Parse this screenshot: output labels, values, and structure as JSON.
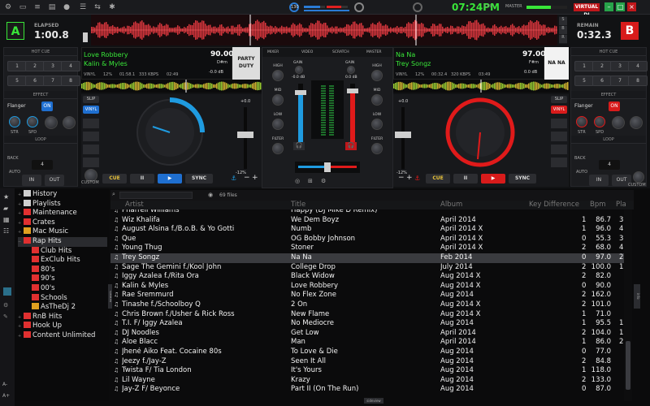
{
  "topbar": {
    "clock": "07:24PM",
    "cpu_label": "CPU",
    "master_label": "MASTER",
    "brand": "VIRTUAL DJ",
    "icons": [
      "settings-icon",
      "monitor-icon",
      "mixer-icon",
      "sampler-icon",
      "record-icon",
      "playlist-icon",
      "sync-icon",
      "gear-icon"
    ],
    "meter_colors": [
      "#2a7bd5",
      "#e02020",
      "#2a7bd5",
      "#e02020",
      "#aaaaaa"
    ],
    "window_buttons": [
      {
        "name": "min",
        "color": "#27a34a"
      },
      {
        "name": "max",
        "color": "#27a34a"
      },
      {
        "name": "close",
        "color": "#c0171b"
      }
    ],
    "badge": "130"
  },
  "deckA": {
    "letter": "A",
    "time_label": "ELAPSED",
    "time": "1:00.8",
    "hot_cue_label": "HOT CUE",
    "hot_cues": [
      "1",
      "2",
      "3",
      "4",
      "5",
      "6",
      "7",
      "8"
    ],
    "effect_label": "EFFECT",
    "effect_name": "Flanger",
    "effect_on": "ON",
    "effect_knobs": [
      "STR",
      "SPD"
    ],
    "loop_label": "LOOP",
    "loop_value": "4",
    "back_label": "BACK",
    "auto_label": "AUTO",
    "in_label": "IN",
    "out_label": "OUT",
    "custom_label": "CUSTOM",
    "slip_label": "SLIP",
    "vinyl_label": "VINYL",
    "title": "Love Robbery",
    "artist": "Kalin & Myles",
    "bpm": "90.00",
    "key": "D#m",
    "gain": "-0.0 dB",
    "info_vinyl": "VINYL",
    "info_pitch": "12%",
    "info_time": "01:58.1",
    "info_kbps": "333 KBPS",
    "info_remain": "02:49",
    "pitch_max": "+0.0",
    "pitch_min": "-12%",
    "cue_label": "CUE",
    "play_symbol": "▶",
    "pause_symbol": "II",
    "sync_label": "SYNC",
    "accent": "#1f9be0",
    "art_text": "PARTY\nDUTY"
  },
  "deckB": {
    "letter": "B",
    "time_label": "REMAIN",
    "time": "0:32.3",
    "hot_cue_label": "HOT CUE",
    "hot_cues": [
      "1",
      "2",
      "3",
      "4",
      "5",
      "6",
      "7",
      "8"
    ],
    "effect_label": "EFFECT",
    "effect_name": "Flanger",
    "effect_on": "ON",
    "effect_knobs": [
      "STR",
      "SPD"
    ],
    "loop_label": "LOOP",
    "loop_value": "4",
    "back_label": "BACK",
    "auto_label": "AUTO",
    "in_label": "IN",
    "out_label": "OUT",
    "custom_label": "CUSTOM",
    "slip_label": "SLIP",
    "vinyl_label": "VINYL",
    "title": "Na Na",
    "artist": "Trey Songz",
    "bpm": "97.00",
    "key": "F#m",
    "gain": "0.0 dB",
    "info_vinyl": "VINYL",
    "info_pitch": "12%",
    "info_time": "00:32.4",
    "info_kbps": "320 KBPS",
    "info_remain": "03:49",
    "pitch_max": "+0.0",
    "pitch_min": "-12%",
    "cue_label": "CUE",
    "play_symbol": "▶",
    "pause_symbol": "II",
    "sync_label": "SYNC",
    "accent": "#e01a1a",
    "art_text": "NA NA"
  },
  "mixer": {
    "tabs": [
      "MIXER",
      "VIDEO",
      "SCRATCH",
      "MASTER"
    ],
    "knobs": [
      "GAIN",
      "HIGH",
      "MID",
      "LOW",
      "FILTER"
    ],
    "gain_a": "-0.0 dB",
    "gain_b": "0.0 dB"
  },
  "browser": {
    "tree": [
      {
        "label": "History",
        "color": "#cfcfcf",
        "indent": 0,
        "expand": "+"
      },
      {
        "label": "Playlists",
        "color": "#cfcfcf",
        "indent": 0,
        "expand": "+"
      },
      {
        "label": "Maintenance",
        "color": "#e03030",
        "indent": 0,
        "expand": "+"
      },
      {
        "label": "Crates",
        "color": "#e03030",
        "indent": 0,
        "expand": "+"
      },
      {
        "label": "Mac Music",
        "color": "#e0a020",
        "indent": 0,
        "expand": "+"
      },
      {
        "label": "Rap Hits",
        "color": "#e03030",
        "indent": 0,
        "expand": "−",
        "selected": true
      },
      {
        "label": "Club Hits",
        "color": "#e03030",
        "indent": 1,
        "expand": ""
      },
      {
        "label": "ExClub Hits",
        "color": "#e03030",
        "indent": 1,
        "expand": ""
      },
      {
        "label": "80's",
        "color": "#e03030",
        "indent": 1,
        "expand": ""
      },
      {
        "label": "90's",
        "color": "#e03030",
        "indent": 1,
        "expand": ""
      },
      {
        "label": "00's",
        "color": "#e03030",
        "indent": 1,
        "expand": ""
      },
      {
        "label": "Schools",
        "color": "#e03030",
        "indent": 1,
        "expand": ""
      },
      {
        "label": "AsTheDj 2",
        "color": "#e0a020",
        "indent": 1,
        "expand": ""
      },
      {
        "label": "RnB Hits",
        "color": "#e03030",
        "indent": 0,
        "expand": "+"
      },
      {
        "label": "Hook Up",
        "color": "#e03030",
        "indent": 0,
        "expand": "+"
      },
      {
        "label": "Content Unlimited",
        "color": "#e03030",
        "indent": 0,
        "expand": "+"
      }
    ],
    "search_placeholder": "",
    "file_count": "69 files",
    "columns": [
      "Artist",
      "Title",
      "Album",
      "Key Difference",
      "Bpm",
      "Pla"
    ],
    "rows": [
      {
        "artist": "Pharrell Williams",
        "title": "Happy (DJ Mike D Remix)",
        "album": "",
        "keydiff": "",
        "bpm": "",
        "plays": ""
      },
      {
        "artist": "Wiz Khalifa",
        "title": "We Dem Boyz",
        "album": "April 2014",
        "keydiff": "1",
        "bpm": "86.7",
        "plays": "3"
      },
      {
        "artist": "August Alsina f./B.o.B. & Yo Gotti",
        "title": "Numb",
        "album": "April 2014 X",
        "keydiff": "1",
        "bpm": "96.0",
        "plays": "4"
      },
      {
        "artist": "Que",
        "title": "OG Bobby Johnson",
        "album": "April 2014 X",
        "keydiff": "0",
        "bpm": "55.3",
        "plays": "3"
      },
      {
        "artist": "Young Thug",
        "title": "Stoner",
        "album": "April 2014 X",
        "keydiff": "2",
        "bpm": "68.0",
        "plays": "4"
      },
      {
        "artist": "Trey Songz",
        "title": "Na Na",
        "album": "Feb 2014",
        "keydiff": "0",
        "bpm": "97.0",
        "plays": "2",
        "selected": true
      },
      {
        "artist": "Sage The Gemini f./Kool John",
        "title": "College Drop",
        "album": "July 2014",
        "keydiff": "2",
        "bpm": "100.0",
        "plays": "1"
      },
      {
        "artist": "Iggy Azalea f./Rita Ora",
        "title": "Black Widow",
        "album": "Aug 2014 X",
        "keydiff": "2",
        "bpm": "82.0",
        "plays": ""
      },
      {
        "artist": "Kalin & Myles",
        "title": "Love Robbery",
        "album": "Aug 2014 X",
        "keydiff": "0",
        "bpm": "90.0",
        "plays": ""
      },
      {
        "artist": "Rae Sremmurd",
        "title": "No Flex Zone",
        "album": "Aug 2014",
        "keydiff": "2",
        "bpm": "162.0",
        "plays": ""
      },
      {
        "artist": "Tinashe f./Schoolboy Q",
        "title": "2 On",
        "album": "Aug 2014 X",
        "keydiff": "2",
        "bpm": "101.0",
        "plays": ""
      },
      {
        "artist": "Chris Brown f./Usher & Rick Ross",
        "title": "New Flame",
        "album": "Aug 2014 X",
        "keydiff": "1",
        "bpm": "71.0",
        "plays": ""
      },
      {
        "artist": "T.I. F/ Iggy Azalea",
        "title": "No Mediocre",
        "album": "Aug 2014",
        "keydiff": "1",
        "bpm": "95.5",
        "plays": "1"
      },
      {
        "artist": "DJ Noodles",
        "title": "Get Low",
        "album": "April 2014",
        "keydiff": "2",
        "bpm": "104.0",
        "plays": "1"
      },
      {
        "artist": "Aloe Blacc",
        "title": "Man",
        "album": "April 2014",
        "keydiff": "1",
        "bpm": "86.0",
        "plays": "2"
      },
      {
        "artist": "Jhené Aiko Feat. Cocaine 80s",
        "title": "To Love & Die",
        "album": "Aug 2014",
        "keydiff": "0",
        "bpm": "77.0",
        "plays": ""
      },
      {
        "artist": "Jeezy f./Jay-Z",
        "title": "Seen It All",
        "album": "Aug 2014",
        "keydiff": "2",
        "bpm": "84.8",
        "plays": ""
      },
      {
        "artist": "Twista F/ Tia London",
        "title": "It's Yours",
        "album": "Aug 2014",
        "keydiff": "1",
        "bpm": "118.0",
        "plays": ""
      },
      {
        "artist": "Lil Wayne",
        "title": "Krazy",
        "album": "Aug 2014",
        "keydiff": "2",
        "bpm": "133.0",
        "plays": ""
      },
      {
        "artist": "Jay-Z F/ Beyonce",
        "title": "Part II (On The Run)",
        "album": "Aug 2014",
        "keydiff": "0",
        "bpm": "87.0",
        "plays": ""
      }
    ],
    "sidebar_icons": [
      "star-icon",
      "folder-icon",
      "grid-icon",
      "side-list-icon"
    ],
    "side_tabs": [
      "SAMPLER",
      "info"
    ],
    "side_sizes": [
      "A-",
      "A+"
    ],
    "sideview_label": "sideview"
  }
}
